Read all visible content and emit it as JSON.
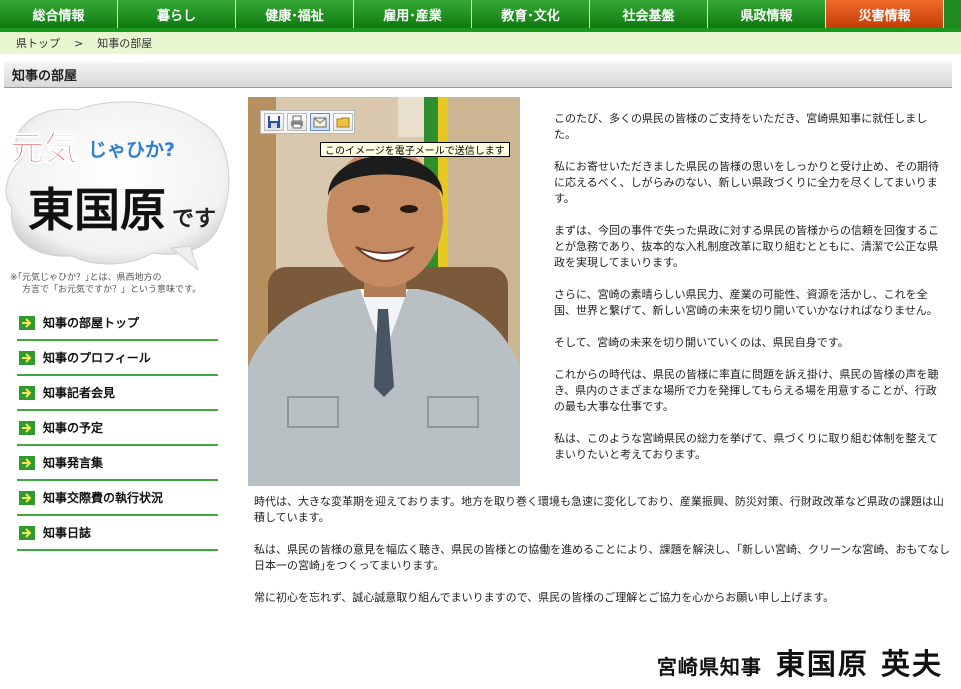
{
  "top_nav": {
    "items": [
      {
        "label": "総合情報"
      },
      {
        "label": "暮らし"
      },
      {
        "label": "健康･福祉"
      },
      {
        "label": "雇用･産業"
      },
      {
        "label": "教育･文化"
      },
      {
        "label": "社会基盤"
      },
      {
        "label": "県政情報"
      },
      {
        "label": "災害情報"
      }
    ],
    "disaster_color": "#d9541a",
    "nav_color": "#1f8a1f"
  },
  "breadcrumb": {
    "home": "県トップ",
    "separator": ">",
    "current": "知事の部屋"
  },
  "page_title": "知事の部屋",
  "logo": {
    "line1_a": "元気",
    "line1_b": "じゃひか?",
    "line2_a": "東国原",
    "line2_b": "です",
    "note_line1": "※｢元気じゃひか？｣とは、県西地方の",
    "note_line2": "方言で「お元気ですか？」という意味です。"
  },
  "side_menu": {
    "items": [
      {
        "label": "知事の部屋トップ"
      },
      {
        "label": "知事のプロフィール"
      },
      {
        "label": "知事記者会見"
      },
      {
        "label": "知事の予定"
      },
      {
        "label": "知事発言集"
      },
      {
        "label": "知事交際費の執行状況"
      },
      {
        "label": "知事日誌"
      }
    ]
  },
  "image_toolbar": {
    "icons": [
      "save-icon",
      "print-icon",
      "email-icon",
      "folder-icon"
    ],
    "tooltip": "このイメージを電子メールで送信します"
  },
  "body_right": [
    "このたび、多くの県民の皆様のご支持をいただき、宮崎県知事に就任しました。",
    "私にお寄せいただきました県民の皆様の思いをしっかりと受け止め、その期待に応えるべく、しがらみのない、新しい県政づくりに全力を尽くしてまいります。",
    "まずは、今回の事件で失った県政に対する県民の皆様からの信頼を回復することが急務であり、抜本的な入札制度改革に取り組むとともに、清潔で公正な県政を実現してまいります。",
    "さらに、宮崎の素晴らしい県民力、産業の可能性、資源を活かし、これを全国、世界と繋げて、新しい宮崎の未来を切り開いていかなければなりません。",
    "そして、宮崎の未来を切り開いていくのは、県民自身です。",
    "これからの時代は、県民の皆様に率直に問題を訴え掛け、県民の皆様の声を聴き、県内のさまざまな場所で力を発揮してもらえる場を用意することが、行政の最も大事な仕事です。",
    "私は、このような宮崎県民の総力を挙げて、県づくりに取り組む体制を整えてまいりたいと考えております。"
  ],
  "body_bottom": [
    "時代は、大きな変革期を迎えております。地方を取り巻く環境も急速に変化しており、産業振興、防災対策、行財政改革など県政の課題は山積しています。",
    "私は、県民の皆様の意見を幅広く聴き、県民の皆様との協働を進めることにより、課題を解決し、｢新しい宮崎、クリーンな宮崎、おもてなし日本一の宮崎｣をつくってまいります。",
    "常に初心を忘れず、誠心誠意取り組んでまいりますので、県民の皆様のご理解とご協力を心からお願い申し上げます。"
  ],
  "signature": {
    "title": "宮崎県知事",
    "name": "東国原 英夫"
  }
}
